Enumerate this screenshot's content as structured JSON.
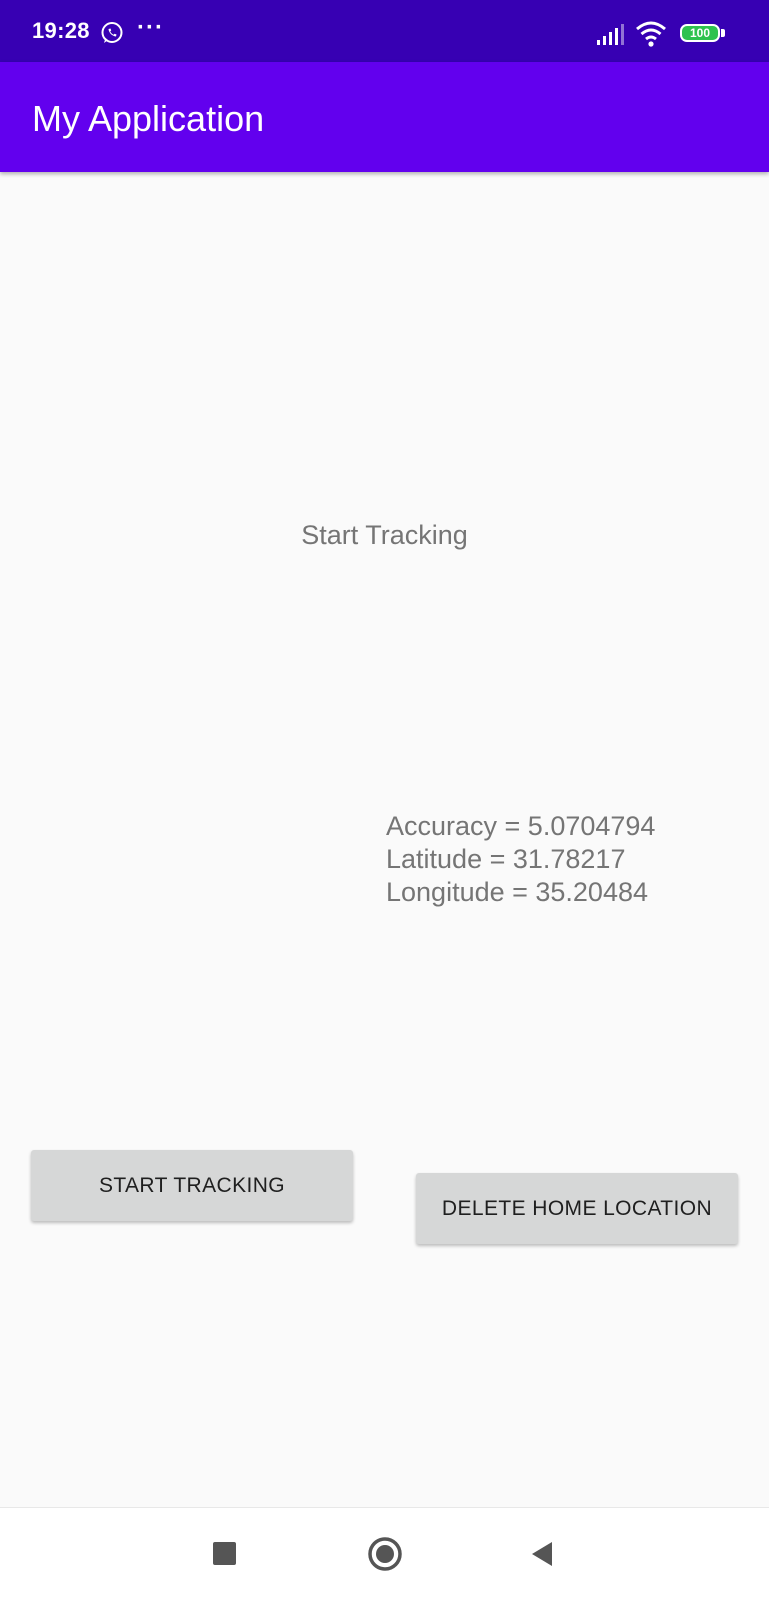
{
  "status_bar": {
    "time": "19:28",
    "more": "···",
    "battery_level": "100",
    "icons": [
      "whatsapp-icon",
      "signal-icon",
      "wifi-icon",
      "battery-icon"
    ]
  },
  "app_bar": {
    "title": "My Application"
  },
  "main": {
    "status_label": "Start Tracking",
    "location": {
      "accuracy": "Accuracy = 5.0704794",
      "latitude": "Latitude = 31.78217",
      "longitude": "Longitude = 35.20484"
    },
    "buttons": {
      "start_tracking": "START TRACKING",
      "delete_home_location": "DELETE HOME LOCATION"
    }
  },
  "nav_bar": {
    "icons": [
      "recents-icon",
      "home-icon",
      "back-icon"
    ]
  },
  "colors": {
    "status_bar": "#3700b3",
    "app_bar": "#6200ee",
    "button_bg": "#d6d7d7",
    "text_secondary": "#757575"
  }
}
